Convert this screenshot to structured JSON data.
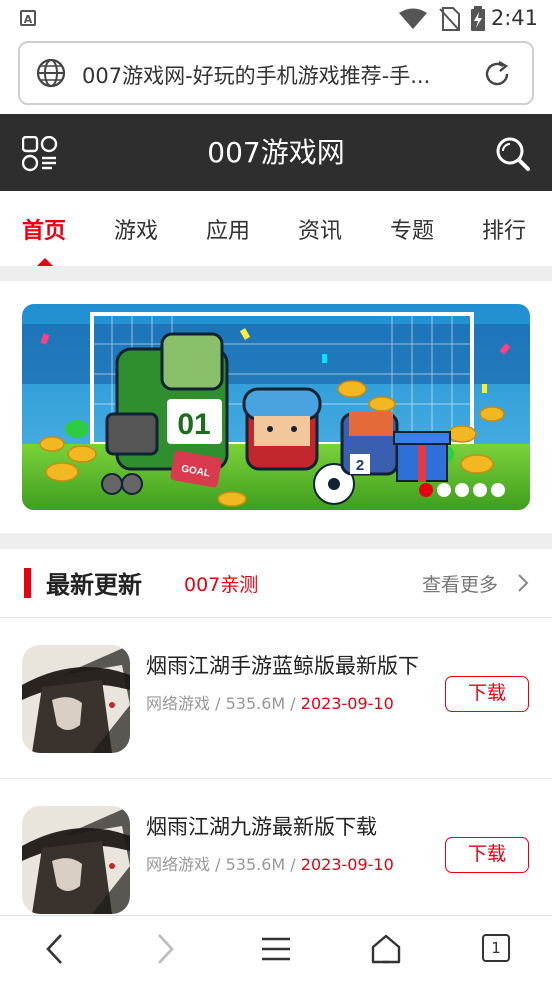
{
  "status_bar": {
    "time": "2:41",
    "app_icon_letter": "A"
  },
  "address_bar": {
    "url_text": "007游戏网-好玩的手机游戏推荐-手..."
  },
  "header": {
    "title": "007游戏网",
    "menu_icon": "grid-menu-icon",
    "search_icon": "search-icon"
  },
  "nav": {
    "tabs": [
      "首页",
      "游戏",
      "应用",
      "资讯",
      "专题",
      "排行"
    ],
    "active_index": 0
  },
  "banner": {
    "slide_count": 5,
    "active_slide": 0,
    "sign_text": "GOAL",
    "jersey_number": "01",
    "badge_number": "2"
  },
  "section": {
    "title": "最新更新",
    "subtitle": "007亲测",
    "more_label": "查看更多"
  },
  "items": [
    {
      "title": "烟雨江湖手游蓝鲸版最新版下",
      "category": "网络游戏",
      "size": "535.6M",
      "date": "2023-09-10",
      "button": "下载"
    },
    {
      "title": "烟雨江湖九游最新版下载",
      "category": "网络游戏",
      "size": "535.6M",
      "date": "2023-09-10",
      "button": "下载"
    }
  ],
  "bottom_bar": {
    "tab_count": "1"
  },
  "colors": {
    "accent": "#e60012",
    "header_bg": "#2e2e2e"
  }
}
